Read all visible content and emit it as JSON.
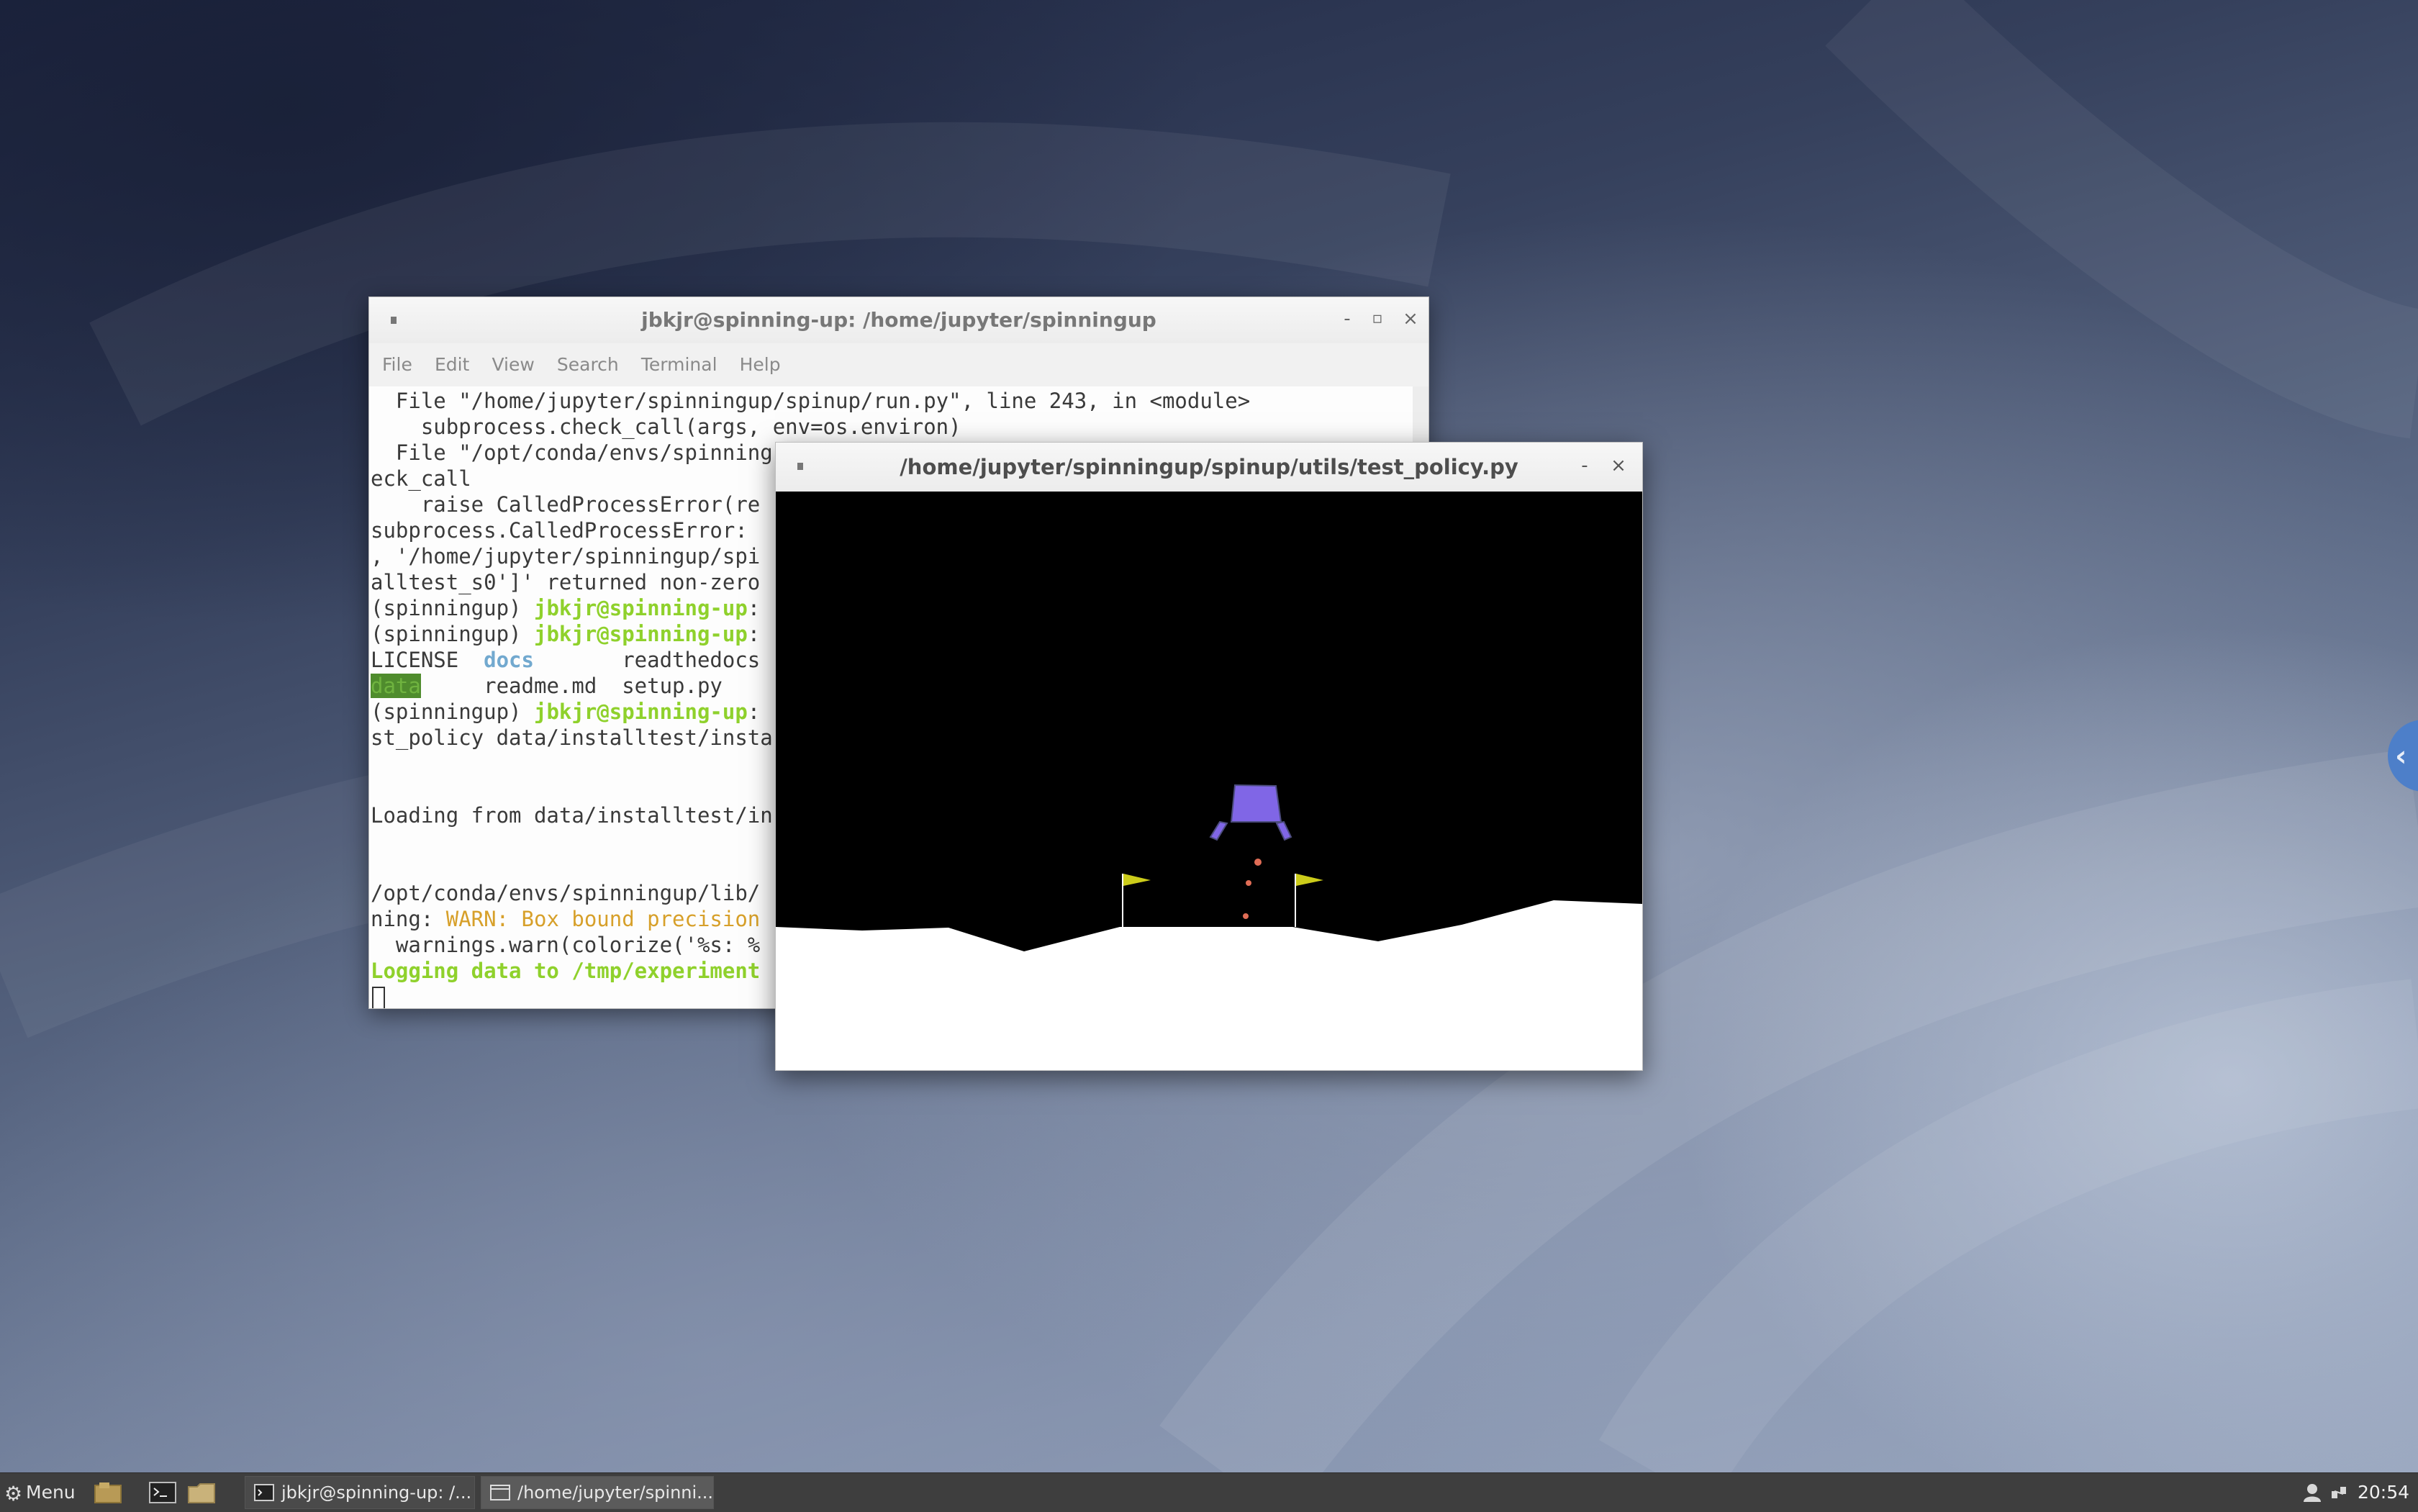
{
  "terminal": {
    "title": "jbkjr@spinning-up: /home/jupyter/spinningup",
    "menu": [
      "File",
      "Edit",
      "View",
      "Search",
      "Terminal",
      "Help"
    ],
    "lines": [
      [
        "  File \"/home/jupyter/spinningup/spinup/run.py\", line 243, in <module>"
      ],
      [
        "    subprocess.check_call(args, env=os.environ)"
      ],
      [
        "  File \"/opt/conda/envs/spinning"
      ],
      [
        "eck_call"
      ],
      [
        "    raise CalledProcessError(re"
      ],
      [
        "subprocess.CalledProcessError: "
      ],
      [
        ", '/home/jupyter/spinningup/spi"
      ],
      [
        "alltest_s0']' returned non-zero"
      ],
      [
        "(spinningup) ",
        "jbkjr@spinning-up",
        ":"
      ],
      [
        "(spinningup) ",
        "jbkjr@spinning-up",
        ":"
      ],
      [
        "LICENSE  ",
        "docs",
        "       readthedocs"
      ],
      [
        "data",
        "     readme.md  setup.py"
      ],
      [
        "(spinningup) ",
        "jbkjr@spinning-up",
        ":"
      ],
      [
        "st_policy data/installtest/insta"
      ],
      [
        ""
      ],
      [
        ""
      ],
      [
        "Loading from data/installtest/in"
      ],
      [
        ""
      ],
      [
        ""
      ],
      [
        "/opt/conda/envs/spinningup/lib/"
      ],
      [
        "ning: ",
        "WARN: Box bound precision"
      ],
      [
        "  warnings.warn(colorize('%s: %"
      ],
      [
        "Logging data to /tmp/experiment"
      ]
    ]
  },
  "gym": {
    "title": "/home/jupyter/spinningup/spinup/utils/test_policy.py",
    "colors": {
      "sky": "#000000",
      "ground": "#ffffff",
      "lander": "#8066e6",
      "lander_outline": "#4d4d80",
      "flag": "#cccc1a",
      "particle": "#e06d56"
    }
  },
  "taskbar": {
    "menu_label": "Menu",
    "tasks": [
      {
        "label": "jbkjr@spinning-up: /...",
        "icon": "terminal-icon"
      },
      {
        "label": "/home/jupyter/spinni...",
        "icon": "window-icon"
      }
    ],
    "clock": "20:54"
  },
  "controls": {
    "minimize": "-",
    "maximize": "▫",
    "close": "×"
  },
  "side_handle": "‹"
}
